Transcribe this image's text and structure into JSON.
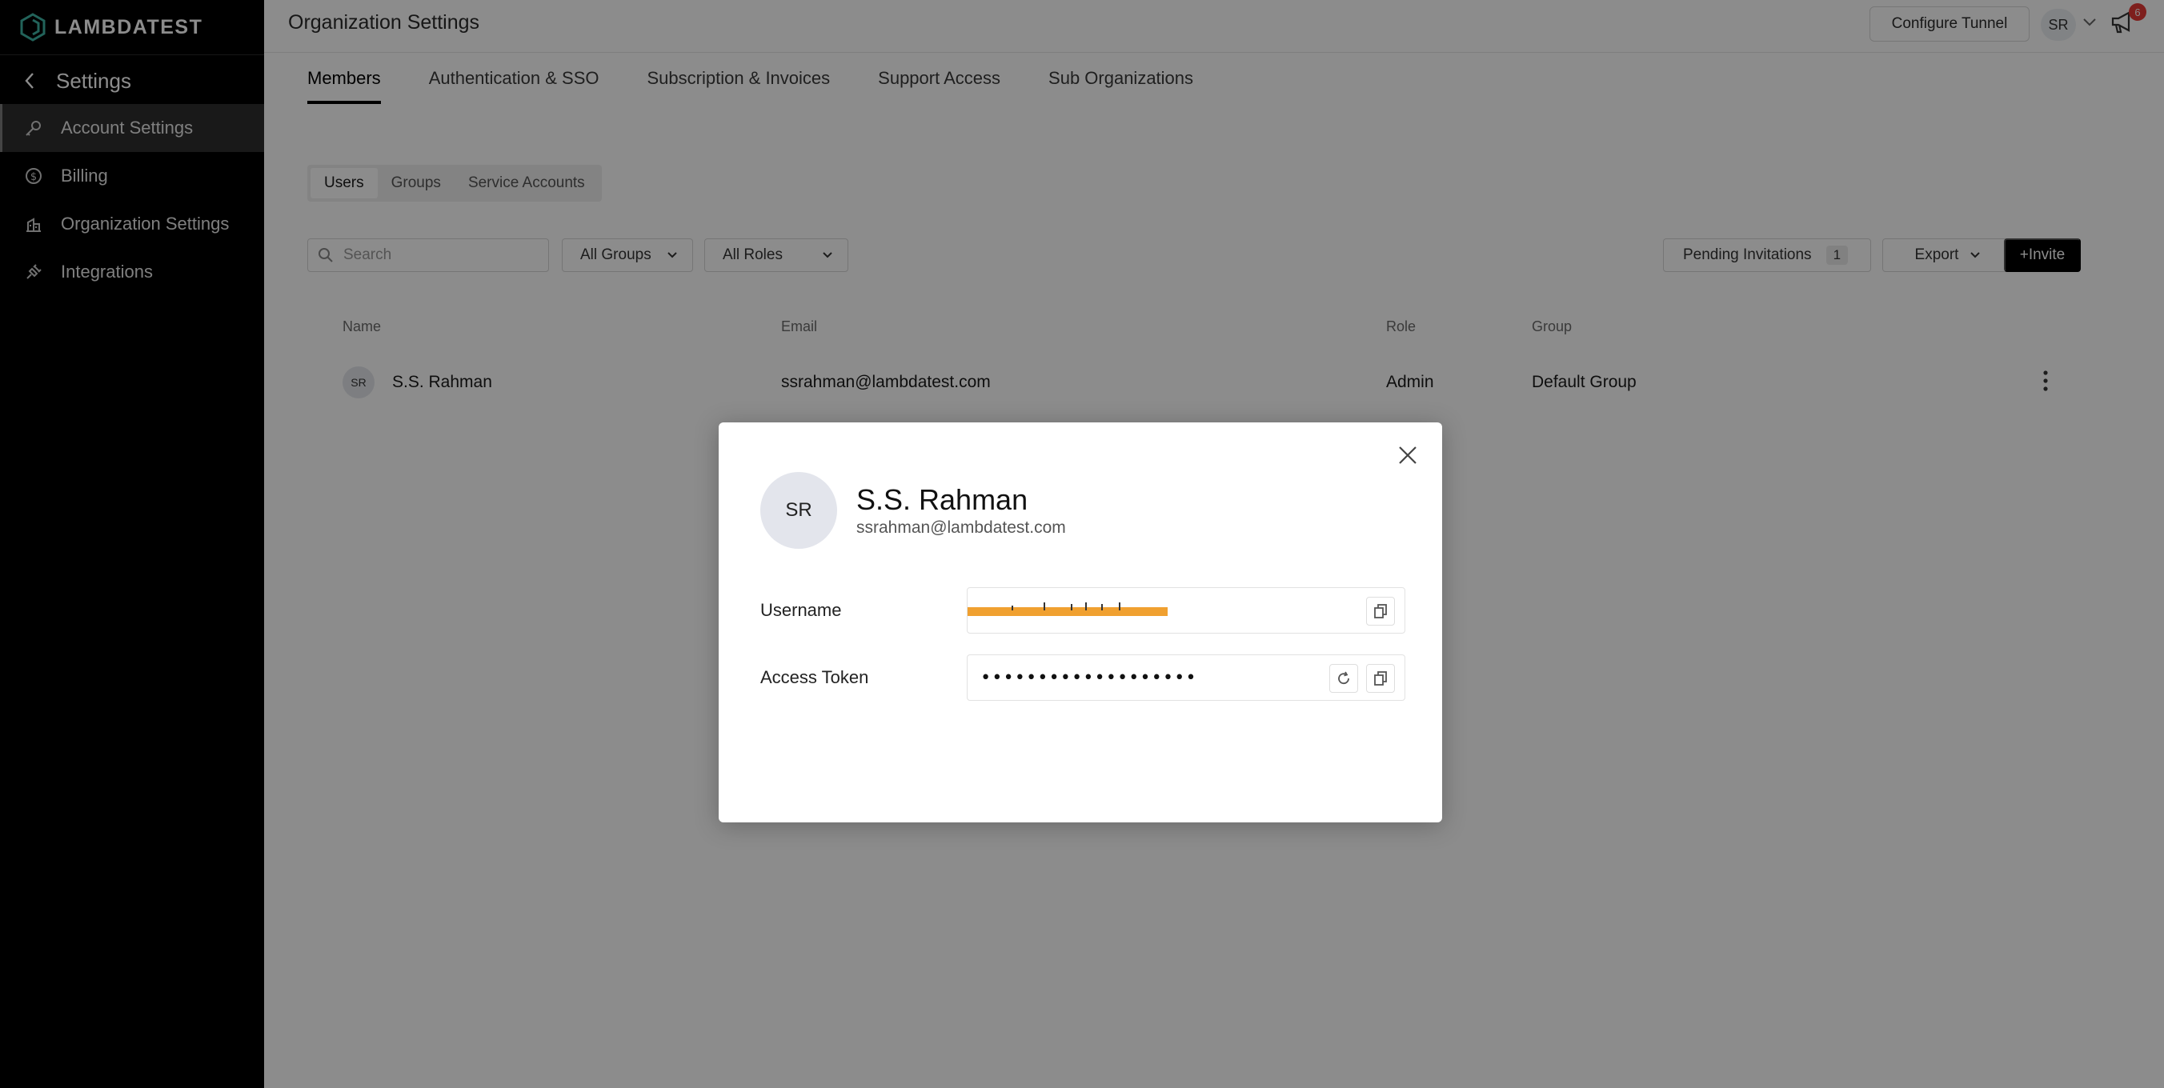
{
  "brand": {
    "logo_text": "LAMBDATEST"
  },
  "sidebar": {
    "back_label": "Settings",
    "items": [
      {
        "label": "Account Settings",
        "icon": "key-icon",
        "active": true
      },
      {
        "label": "Billing",
        "icon": "dollar-icon",
        "active": false
      },
      {
        "label": "Organization Settings",
        "icon": "building-icon",
        "active": false
      },
      {
        "label": "Integrations",
        "icon": "plug-icon",
        "active": false
      }
    ]
  },
  "header": {
    "title": "Organization Settings",
    "configure_tunnel": "Configure Tunnel",
    "user_initials": "SR",
    "notification_count": "6"
  },
  "tabs": [
    "Members",
    "Authentication & SSO",
    "Subscription & Invoices",
    "Support Access",
    "Sub Organizations"
  ],
  "subtabs": [
    "Users",
    "Groups",
    "Service Accounts"
  ],
  "filters": {
    "search_placeholder": "Search",
    "groups": "All Groups",
    "roles": "All Roles",
    "pending_label": "Pending Invitations",
    "pending_count": "1",
    "export": "Export",
    "invite": "+Invite"
  },
  "table": {
    "headers": [
      "Name",
      "Email",
      "Role",
      "Group"
    ],
    "rows": [
      {
        "initials": "SR",
        "name": "S.S. Rahman",
        "email": "ssrahman@lambdatest.com",
        "role": "Admin",
        "group": "Default Group"
      }
    ]
  },
  "modal": {
    "initials": "SR",
    "name": "S.S. Rahman",
    "email": "ssrahman@lambdatest.com",
    "username_label": "Username",
    "access_token_label": "Access Token",
    "access_token_masked": "•••••••••••••••••••",
    "redaction_color": "#f0a030"
  }
}
